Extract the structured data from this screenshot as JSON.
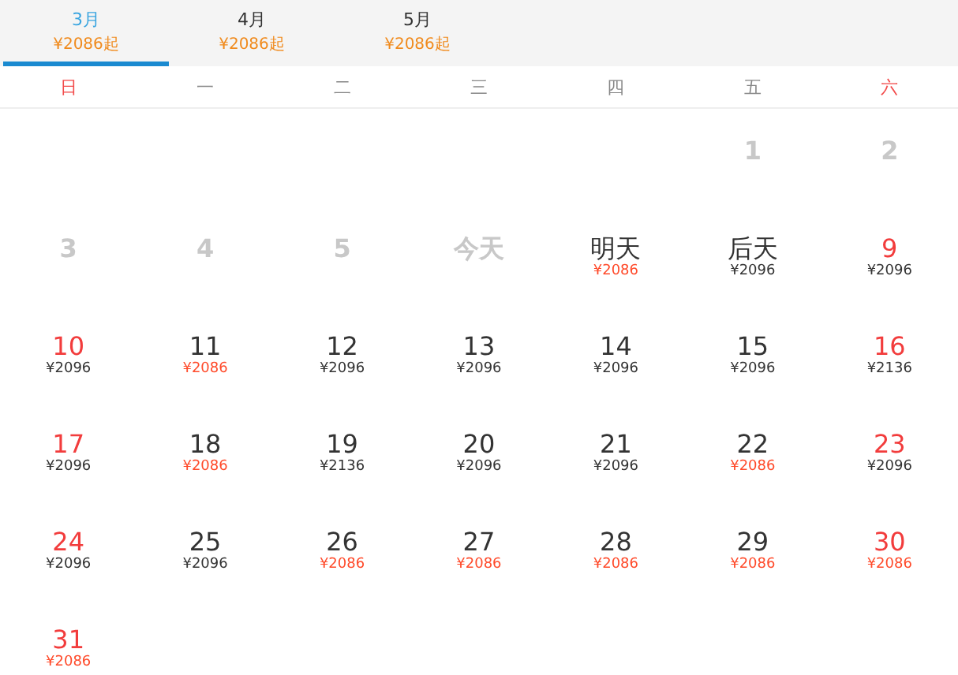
{
  "month_tabs": [
    {
      "month": "3月",
      "price": "¥2086起",
      "selected": true
    },
    {
      "month": "4月",
      "price": "¥2086起",
      "selected": false
    },
    {
      "month": "5月",
      "price": "¥2086起",
      "selected": false
    }
  ],
  "weekdays": [
    "日",
    "一",
    "二",
    "三",
    "四",
    "五",
    "六"
  ],
  "weeks": [
    [
      {
        "day": "1",
        "disabled": true
      },
      {
        "day": "2",
        "disabled": true
      }
    ],
    [
      {
        "day": "3",
        "disabled": true
      },
      {
        "day": "4",
        "disabled": true
      },
      {
        "day": "5",
        "disabled": true
      },
      {
        "day": "今天",
        "disabled": true
      },
      {
        "day": "明天",
        "disabled": false,
        "price": "¥2086",
        "low": true
      },
      {
        "day": "后天",
        "disabled": false,
        "price": "¥2096",
        "low": false
      },
      {
        "day": "9",
        "disabled": false,
        "price": "¥2096",
        "low": false
      }
    ],
    [
      {
        "day": "10",
        "disabled": false,
        "price": "¥2096",
        "low": false
      },
      {
        "day": "11",
        "disabled": false,
        "price": "¥2086",
        "low": true
      },
      {
        "day": "12",
        "disabled": false,
        "price": "¥2096",
        "low": false
      },
      {
        "day": "13",
        "disabled": false,
        "price": "¥2096",
        "low": false
      },
      {
        "day": "14",
        "disabled": false,
        "price": "¥2096",
        "low": false
      },
      {
        "day": "15",
        "disabled": false,
        "price": "¥2096",
        "low": false
      },
      {
        "day": "16",
        "disabled": false,
        "price": "¥2136",
        "low": false
      }
    ],
    [
      {
        "day": "17",
        "disabled": false,
        "price": "¥2096",
        "low": false
      },
      {
        "day": "18",
        "disabled": false,
        "price": "¥2086",
        "low": true
      },
      {
        "day": "19",
        "disabled": false,
        "price": "¥2136",
        "low": false
      },
      {
        "day": "20",
        "disabled": false,
        "price": "¥2096",
        "low": false
      },
      {
        "day": "21",
        "disabled": false,
        "price": "¥2096",
        "low": false
      },
      {
        "day": "22",
        "disabled": false,
        "price": "¥2086",
        "low": true
      },
      {
        "day": "23",
        "disabled": false,
        "price": "¥2096",
        "low": false
      }
    ],
    [
      {
        "day": "24",
        "disabled": false,
        "price": "¥2096",
        "low": false
      },
      {
        "day": "25",
        "disabled": false,
        "price": "¥2096",
        "low": false
      },
      {
        "day": "26",
        "disabled": false,
        "price": "¥2086",
        "low": true
      },
      {
        "day": "27",
        "disabled": false,
        "price": "¥2086",
        "low": true
      },
      {
        "day": "28",
        "disabled": false,
        "price": "¥2086",
        "low": true
      },
      {
        "day": "29",
        "disabled": false,
        "price": "¥2086",
        "low": true
      },
      {
        "day": "30",
        "disabled": false,
        "price": "¥2086",
        "low": true
      }
    ],
    [
      {
        "day": "31",
        "disabled": false,
        "price": "¥2086",
        "low": true
      }
    ]
  ]
}
